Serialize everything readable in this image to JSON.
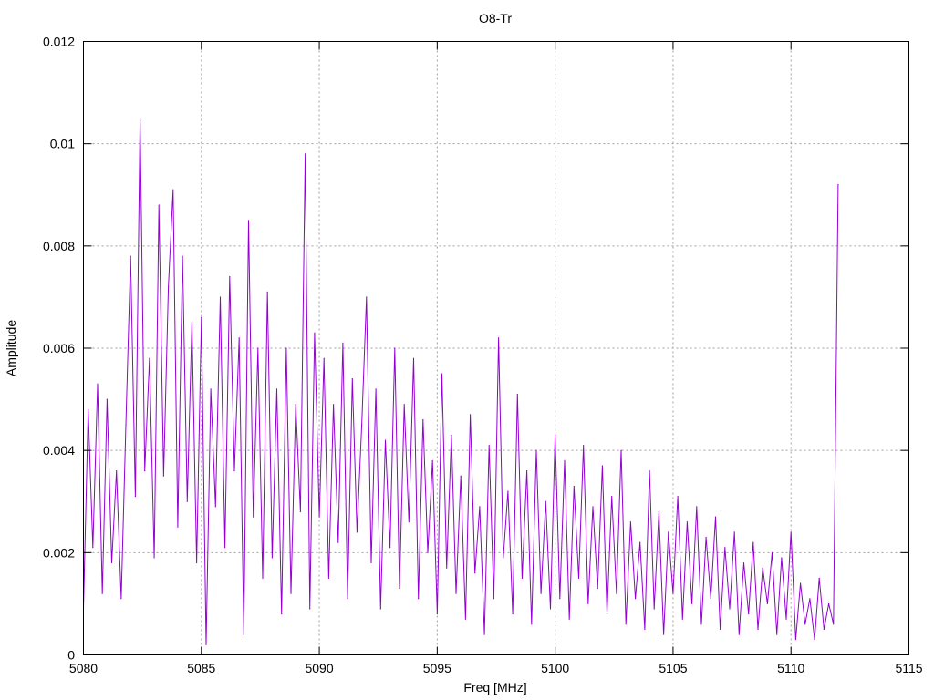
{
  "chart_data": {
    "type": "line",
    "title": "O8-Tr",
    "xlabel": "Freq [MHz]",
    "ylabel": "Amplitude",
    "xlim": [
      5080,
      5115
    ],
    "ylim": [
      0,
      0.012
    ],
    "grid": true,
    "x_ticks": [
      "5080",
      "5085",
      "5090",
      "5095",
      "5100",
      "5105",
      "5110",
      "5115"
    ],
    "y_ticks": [
      "0",
      "0.002",
      "0.004",
      "0.006",
      "0.008",
      "0.01",
      "0.012"
    ],
    "series": [
      {
        "name": "O8-Tr",
        "color": "#9400d3",
        "x_start": 5080.0,
        "x_step": 0.2,
        "values": [
          0.0009,
          0.0048,
          0.0021,
          0.0053,
          0.0012,
          0.005,
          0.0018,
          0.0036,
          0.0011,
          0.0045,
          0.0078,
          0.0031,
          0.0105,
          0.0036,
          0.0058,
          0.0019,
          0.0088,
          0.0035,
          0.0072,
          0.0091,
          0.0025,
          0.0078,
          0.003,
          0.0065,
          0.0018,
          0.0066,
          0.0002,
          0.0052,
          0.0029,
          0.007,
          0.0021,
          0.0074,
          0.0036,
          0.0062,
          0.0004,
          0.0085,
          0.0027,
          0.006,
          0.0015,
          0.0071,
          0.0019,
          0.0052,
          0.0008,
          0.006,
          0.0012,
          0.0049,
          0.0028,
          0.0098,
          0.0009,
          0.0063,
          0.0027,
          0.0058,
          0.0015,
          0.0049,
          0.0022,
          0.0061,
          0.0011,
          0.0054,
          0.0024,
          0.0045,
          0.007,
          0.0018,
          0.0052,
          0.0009,
          0.0042,
          0.0021,
          0.006,
          0.0013,
          0.0049,
          0.0026,
          0.0058,
          0.0011,
          0.0046,
          0.002,
          0.0038,
          0.0008,
          0.0055,
          0.0017,
          0.0043,
          0.0012,
          0.0035,
          0.0007,
          0.0047,
          0.0016,
          0.0029,
          0.0004,
          0.0041,
          0.0011,
          0.0062,
          0.0019,
          0.0032,
          0.0008,
          0.0051,
          0.0015,
          0.0036,
          0.0006,
          0.004,
          0.0012,
          0.003,
          0.0009,
          0.0043,
          0.0011,
          0.0038,
          0.0007,
          0.0033,
          0.0015,
          0.0041,
          0.001,
          0.0029,
          0.0013,
          0.0037,
          0.0008,
          0.0031,
          0.0012,
          0.004,
          0.0006,
          0.0026,
          0.0011,
          0.0022,
          0.0005,
          0.0036,
          0.0009,
          0.0028,
          0.0004,
          0.0024,
          0.0012,
          0.0031,
          0.0007,
          0.0026,
          0.001,
          0.0029,
          0.0006,
          0.0023,
          0.0011,
          0.0027,
          0.0005,
          0.0021,
          0.0009,
          0.0024,
          0.0004,
          0.0018,
          0.0008,
          0.0022,
          0.0005,
          0.0017,
          0.001,
          0.002,
          0.0004,
          0.0019,
          0.0007,
          0.0024,
          0.0003,
          0.0014,
          0.0006,
          0.0011,
          0.0003,
          0.0015,
          0.0005,
          0.001,
          0.0006,
          0.0092
        ]
      }
    ]
  }
}
